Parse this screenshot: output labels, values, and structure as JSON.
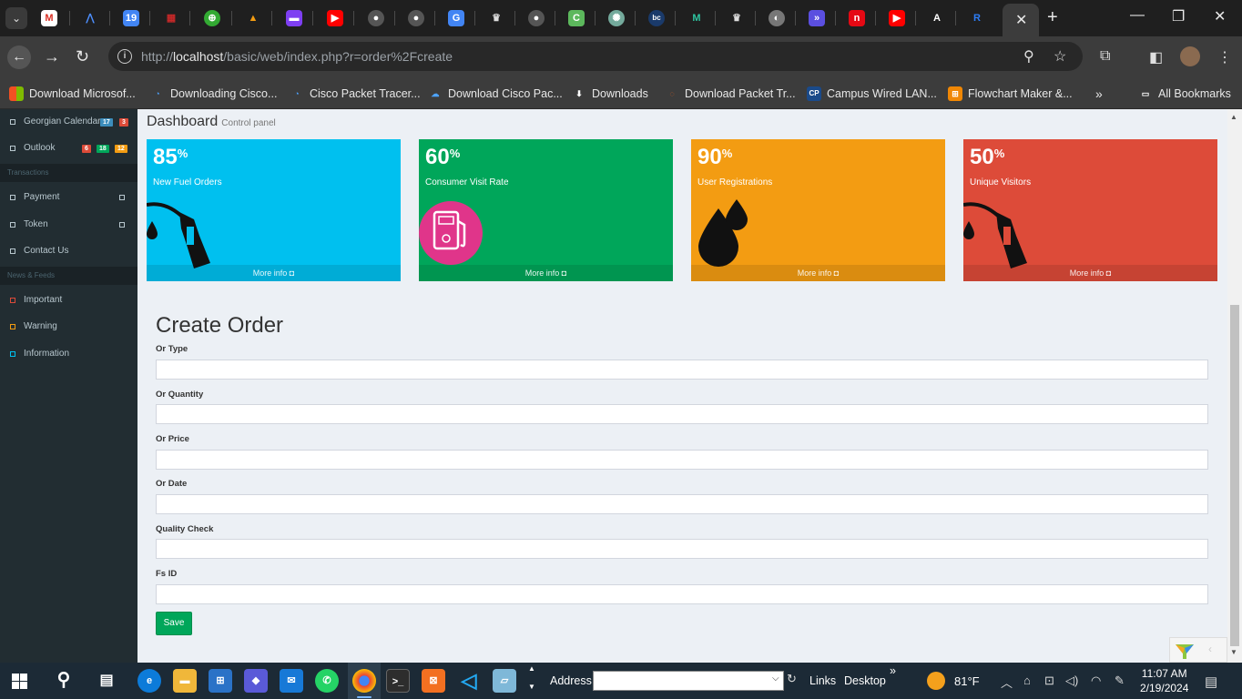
{
  "browser": {
    "url_prefix": "http://",
    "url_host": "localhost",
    "url_path": "/basic/web/index.php?r=order%2Fcreate",
    "tab_close": "✕",
    "new_tab": "+",
    "bookmarks": [
      {
        "label": "Download Microsof...",
        "icon": "windows-icon"
      },
      {
        "label": "Downloading Cisco...",
        "icon": "webex-icon"
      },
      {
        "label": "Cisco Packet Tracer...",
        "icon": "webex-icon"
      },
      {
        "label": "Download Cisco Pac...",
        "icon": "cloud-icon"
      },
      {
        "label": "Downloads",
        "icon": "download-icon"
      },
      {
        "label": "Download Packet Tr...",
        "icon": "spinner-icon"
      },
      {
        "label": "Campus Wired LAN...",
        "icon": "cp-icon"
      },
      {
        "label": "Flowchart Maker &...",
        "icon": "flowchart-icon"
      }
    ],
    "bookmarks_more": "»",
    "all_bookmarks": "All Bookmarks"
  },
  "sidebar": {
    "items_top": [
      {
        "label": "Georgian Calendar",
        "badges": [
          {
            "text": "17",
            "color": "#3c8dbc"
          },
          {
            "text": "3",
            "color": "#dd4b39"
          }
        ]
      },
      {
        "label": "Outlook",
        "badges": [
          {
            "text": "6",
            "color": "#dd4b39"
          },
          {
            "text": "18",
            "color": "#00a65a"
          },
          {
            "text": "12",
            "color": "#f39c12"
          }
        ]
      }
    ],
    "header_transactions": "Transactions",
    "items_transactions": [
      "Payment",
      "Token",
      "Contact Us"
    ],
    "header_news": "News & Feeds",
    "items_news": [
      {
        "label": "Important",
        "color": "#dd4b39"
      },
      {
        "label": "Warning",
        "color": "#f39c12"
      },
      {
        "label": "Information",
        "color": "#00c0ef"
      }
    ]
  },
  "dashboard": {
    "title": "Dashboard",
    "subtitle": "Control panel",
    "boxes": [
      {
        "value": "85",
        "unit": "%",
        "label": "New Fuel Orders",
        "footer": "More info",
        "color": "#00c0ef",
        "icon": "fuel-nozzle-icon"
      },
      {
        "value": "60",
        "unit": "%",
        "label": "Consumer Visit Rate",
        "footer": "More info",
        "color": "#00a65a",
        "icon": "fuel-pump-icon"
      },
      {
        "value": "90",
        "unit": "%",
        "label": "User Registrations",
        "footer": "More info",
        "color": "#f39c12",
        "icon": "oil-drops-icon"
      },
      {
        "value": "50",
        "unit": "%",
        "label": "Unique Visitors",
        "footer": "More info",
        "color": "#dd4b39",
        "icon": "fuel-nozzle-icon"
      }
    ]
  },
  "form": {
    "title": "Create Order",
    "fields": [
      {
        "label": "Or Type",
        "value": ""
      },
      {
        "label": "Or Quantity",
        "value": ""
      },
      {
        "label": "Or Price",
        "value": ""
      },
      {
        "label": "Or Date",
        "value": ""
      },
      {
        "label": "Quality Check",
        "value": ""
      },
      {
        "label": "Fs ID",
        "value": ""
      }
    ],
    "save_label": "Save"
  },
  "taskbar": {
    "address_label": "Address",
    "links": "Links",
    "desktop": "Desktop",
    "more": "»",
    "weather": "81°F",
    "time": "11:07 AM",
    "date": "2/19/2024"
  }
}
